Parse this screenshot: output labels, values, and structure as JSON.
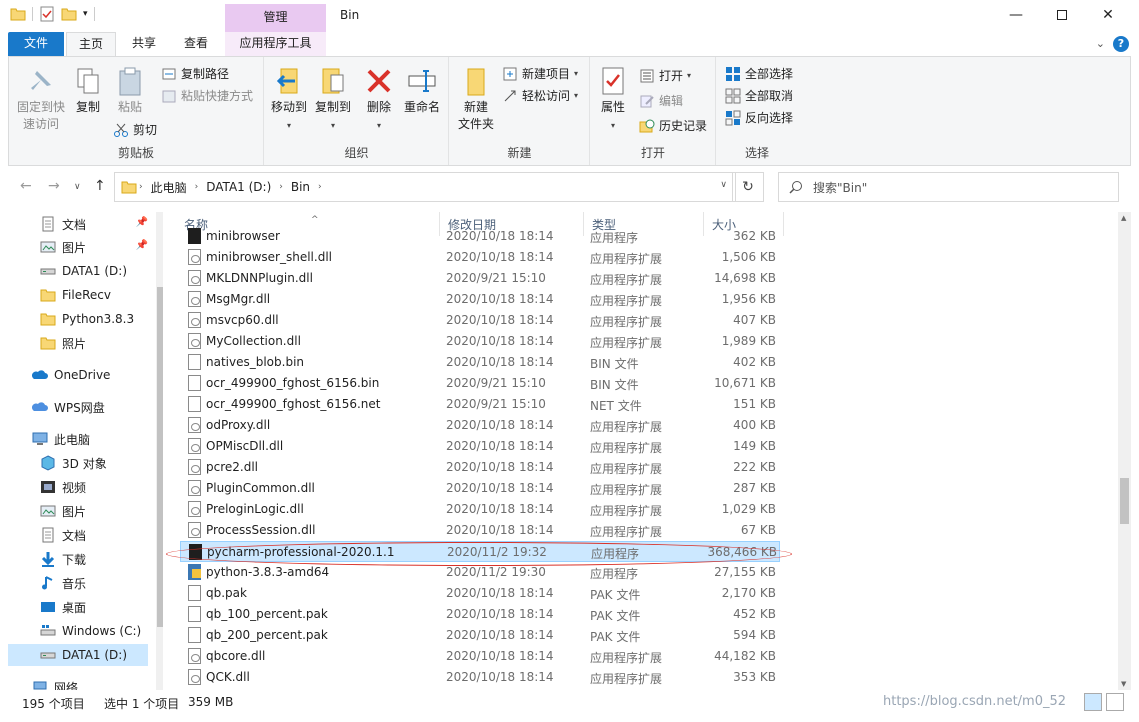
{
  "window": {
    "title": "Bin",
    "context_group": "管理",
    "min_icon": "minimize-icon",
    "max_icon": "maximize-icon",
    "close_icon": "close-icon"
  },
  "tabs": {
    "file": "文件",
    "home": "主页",
    "share": "共享",
    "view": "查看",
    "app_tools": "应用程序工具"
  },
  "ribbon": {
    "clipboard": {
      "label": "剪贴板",
      "pin": "固定到快\n速访问",
      "copy": "复制",
      "paste": "粘贴",
      "copy_path": "复制路径",
      "paste_shortcut": "粘贴快捷方式",
      "cut": "剪切"
    },
    "organize": {
      "label": "组织",
      "move_to": "移动到",
      "copy_to": "复制到",
      "delete": "删除",
      "rename": "重命名"
    },
    "new": {
      "label": "新建",
      "new_folder_line1": "新建",
      "new_folder_line2": "文件夹",
      "new_item": "新建项目",
      "easy_access": "轻松访问"
    },
    "open": {
      "label": "打开",
      "properties": "属性",
      "open": "打开",
      "edit": "编辑",
      "history": "历史记录"
    },
    "select": {
      "label": "选择",
      "select_all": "全部选择",
      "select_none": "全部取消",
      "invert": "反向选择"
    }
  },
  "address": {
    "crumbs": [
      "此电脑",
      "DATA1 (D:)",
      "Bin"
    ],
    "search_placeholder": "搜索\"Bin\""
  },
  "nav": {
    "items": [
      {
        "label": "文档",
        "icon": "documents-icon",
        "pinned": true
      },
      {
        "label": "图片",
        "icon": "pictures-icon",
        "pinned": true
      },
      {
        "label": "DATA1 (D:)",
        "icon": "drive-icon",
        "pinned": false
      },
      {
        "label": "FileRecv",
        "icon": "folder-icon",
        "pinned": false
      },
      {
        "label": "Python3.8.3",
        "icon": "folder-icon",
        "pinned": false
      },
      {
        "label": "照片",
        "icon": "folder-icon",
        "pinned": false
      },
      {
        "label": "OneDrive",
        "icon": "onedrive-icon",
        "pinned": false
      },
      {
        "label": "WPS网盘",
        "icon": "wps-cloud-icon",
        "pinned": false
      },
      {
        "label": "此电脑",
        "icon": "computer-icon",
        "pinned": false
      },
      {
        "label": "3D 对象",
        "icon": "3d-objects-icon",
        "pinned": false
      },
      {
        "label": "视频",
        "icon": "videos-icon",
        "pinned": false
      },
      {
        "label": "图片",
        "icon": "pictures-icon",
        "pinned": false
      },
      {
        "label": "文档",
        "icon": "documents-icon",
        "pinned": false
      },
      {
        "label": "下载",
        "icon": "downloads-icon",
        "pinned": false
      },
      {
        "label": "音乐",
        "icon": "music-icon",
        "pinned": false
      },
      {
        "label": "桌面",
        "icon": "desktop-icon",
        "pinned": false
      },
      {
        "label": "Windows (C:)",
        "icon": "drive-icon",
        "pinned": false
      },
      {
        "label": "DATA1 (D:)",
        "icon": "drive-icon",
        "pinned": false
      },
      {
        "label": "网络",
        "icon": "network-icon",
        "pinned": false
      }
    ]
  },
  "columns": {
    "name": "名称",
    "date": "修改日期",
    "type": "类型",
    "size": "大小"
  },
  "files": [
    {
      "name": "minibrowser",
      "date": "2020/10/18 18:14",
      "type": "应用程序",
      "size": "362 KB",
      "icon": "exe"
    },
    {
      "name": "minibrowser_shell.dll",
      "date": "2020/10/18 18:14",
      "type": "应用程序扩展",
      "size": "1,506 KB",
      "icon": "dll"
    },
    {
      "name": "MKLDNNPlugin.dll",
      "date": "2020/9/21 15:10",
      "type": "应用程序扩展",
      "size": "14,698 KB",
      "icon": "dll"
    },
    {
      "name": "MsgMgr.dll",
      "date": "2020/10/18 18:14",
      "type": "应用程序扩展",
      "size": "1,956 KB",
      "icon": "dll"
    },
    {
      "name": "msvcp60.dll",
      "date": "2020/10/18 18:14",
      "type": "应用程序扩展",
      "size": "407 KB",
      "icon": "dll"
    },
    {
      "name": "MyCollection.dll",
      "date": "2020/10/18 18:14",
      "type": "应用程序扩展",
      "size": "1,989 KB",
      "icon": "dll"
    },
    {
      "name": "natives_blob.bin",
      "date": "2020/10/18 18:14",
      "type": "BIN 文件",
      "size": "402 KB",
      "icon": "file"
    },
    {
      "name": "ocr_499900_fghost_6156.bin",
      "date": "2020/9/21 15:10",
      "type": "BIN 文件",
      "size": "10,671 KB",
      "icon": "file"
    },
    {
      "name": "ocr_499900_fghost_6156.net",
      "date": "2020/9/21 15:10",
      "type": "NET 文件",
      "size": "151 KB",
      "icon": "file"
    },
    {
      "name": "odProxy.dll",
      "date": "2020/10/18 18:14",
      "type": "应用程序扩展",
      "size": "400 KB",
      "icon": "dll"
    },
    {
      "name": "OPMiscDll.dll",
      "date": "2020/10/18 18:14",
      "type": "应用程序扩展",
      "size": "149 KB",
      "icon": "dll"
    },
    {
      "name": "pcre2.dll",
      "date": "2020/10/18 18:14",
      "type": "应用程序扩展",
      "size": "222 KB",
      "icon": "dll"
    },
    {
      "name": "PluginCommon.dll",
      "date": "2020/10/18 18:14",
      "type": "应用程序扩展",
      "size": "287 KB",
      "icon": "dll"
    },
    {
      "name": "PreloginLogic.dll",
      "date": "2020/10/18 18:14",
      "type": "应用程序扩展",
      "size": "1,029 KB",
      "icon": "dll"
    },
    {
      "name": "ProcessSession.dll",
      "date": "2020/10/18 18:14",
      "type": "应用程序扩展",
      "size": "67 KB",
      "icon": "dll"
    },
    {
      "name": "pycharm-professional-2020.1.1",
      "date": "2020/11/2 19:32",
      "type": "应用程序",
      "size": "368,466 KB",
      "icon": "exe",
      "selected": true
    },
    {
      "name": "python-3.8.3-amd64",
      "date": "2020/11/2 19:30",
      "type": "应用程序",
      "size": "27,155 KB",
      "icon": "py"
    },
    {
      "name": "qb.pak",
      "date": "2020/10/18 18:14",
      "type": "PAK 文件",
      "size": "2,170 KB",
      "icon": "file"
    },
    {
      "name": "qb_100_percent.pak",
      "date": "2020/10/18 18:14",
      "type": "PAK 文件",
      "size": "452 KB",
      "icon": "file"
    },
    {
      "name": "qb_200_percent.pak",
      "date": "2020/10/18 18:14",
      "type": "PAK 文件",
      "size": "594 KB",
      "icon": "file"
    },
    {
      "name": "qbcore.dll",
      "date": "2020/10/18 18:14",
      "type": "应用程序扩展",
      "size": "44,182 KB",
      "icon": "dll"
    },
    {
      "name": "QCK.dll",
      "date": "2020/10/18 18:14",
      "type": "应用程序扩展",
      "size": "353 KB",
      "icon": "dll"
    }
  ],
  "status": {
    "count": "195 个项目",
    "selected": "选中 1 个项目",
    "size": "359 MB"
  },
  "watermark": "https://blog.csdn.net/m0_52"
}
